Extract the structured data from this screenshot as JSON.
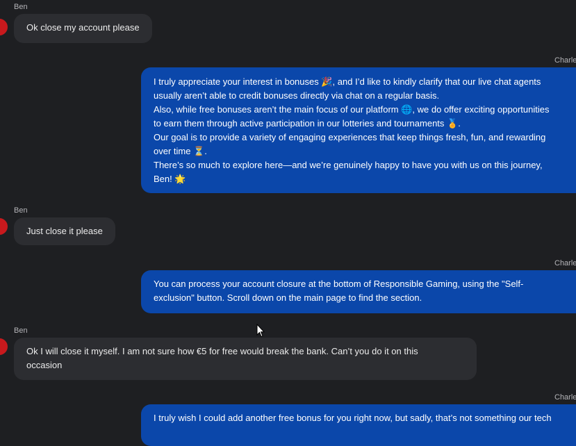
{
  "messages": [
    {
      "sender": "Ben",
      "lines": [
        "Ok close my account please"
      ]
    },
    {
      "sender": "Charle",
      "lines": [
        "I truly appreciate your interest in bonuses 🎉, and I’d like to kindly clarify that our live chat agents",
        "usually aren’t able to credit bonuses directly via chat on a regular basis.",
        "Also, while free bonuses aren’t the main focus of our platform 🌐, we do offer exciting opportunities",
        "to earn them through active participation in our lotteries and tournaments 🏅.",
        "Our goal is to provide a variety of engaging experiences that keep things fresh, fun, and rewarding",
        "over time ⏳.",
        "There’s so much to explore here—and we’re genuinely happy to have you with us on this journey,",
        "Ben! 🌟"
      ]
    },
    {
      "sender": "Ben",
      "lines": [
        "Just close it please"
      ]
    },
    {
      "sender": "Charle",
      "lines": [
        "You can process your account closure at the bottom of Responsible Gaming, using the \"Self-",
        "exclusion\" button. Scroll down on the main page to find the section."
      ]
    },
    {
      "sender": "Ben",
      "lines": [
        "Ok I will close it myself. I am not sure how €5 for free would break the bank. Can’t you do it on this",
        "occasion"
      ]
    },
    {
      "sender": "Charle",
      "lines": [
        "I truly wish I could add another free bonus for you right now, but sadly, that’s not something our tech"
      ]
    }
  ],
  "colors": {
    "background": "#1e1f22",
    "user_bubble": "#2c2d31",
    "agent_bubble": "#0b47aa",
    "avatar": "#c8191d"
  },
  "icons": {
    "avatar": "avatar-icon",
    "cursor": "mouse-pointer-icon"
  }
}
